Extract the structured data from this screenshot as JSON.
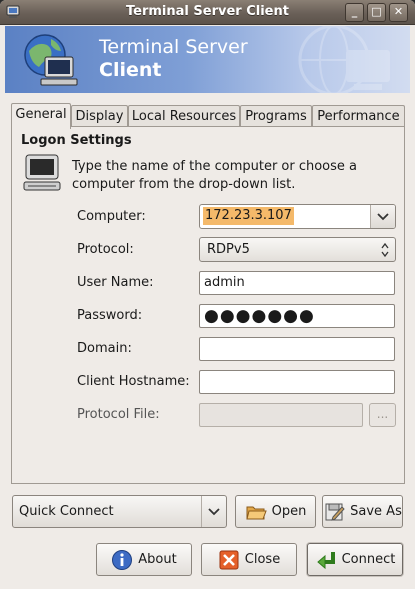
{
  "window": {
    "title": "Terminal Server Client"
  },
  "banner": {
    "line1": "Terminal Server",
    "line2": "Client"
  },
  "tabs": [
    {
      "label": "General"
    },
    {
      "label": "Display"
    },
    {
      "label": "Local Resources"
    },
    {
      "label": "Programs"
    },
    {
      "label": "Performance"
    }
  ],
  "logon": {
    "title": "Logon Settings",
    "instructions": "Type the name of the computer or choose a computer from the drop-down list.",
    "computer_label": "Computer:",
    "computer_value": "172.23.3.107",
    "protocol_label": "Protocol:",
    "protocol_value": "RDPv5",
    "username_label": "User Name:",
    "username_value": "admin",
    "password_label": "Password:",
    "password_value": "●●●●●●●",
    "domain_label": "Domain:",
    "domain_value": "",
    "hostname_label": "Client Hostname:",
    "hostname_value": "",
    "protocol_file_label": "Protocol File:",
    "protocol_file_value": "",
    "browse_label": "..."
  },
  "bottom": {
    "quick_connect": "Quick Connect",
    "open": "Open",
    "save_as": "Save As",
    "about": "About",
    "close": "Close",
    "connect": "Connect"
  },
  "colors": {
    "banner": "#6f93d0",
    "selection": "#f4b96a",
    "titlebar": "#6a6058"
  }
}
